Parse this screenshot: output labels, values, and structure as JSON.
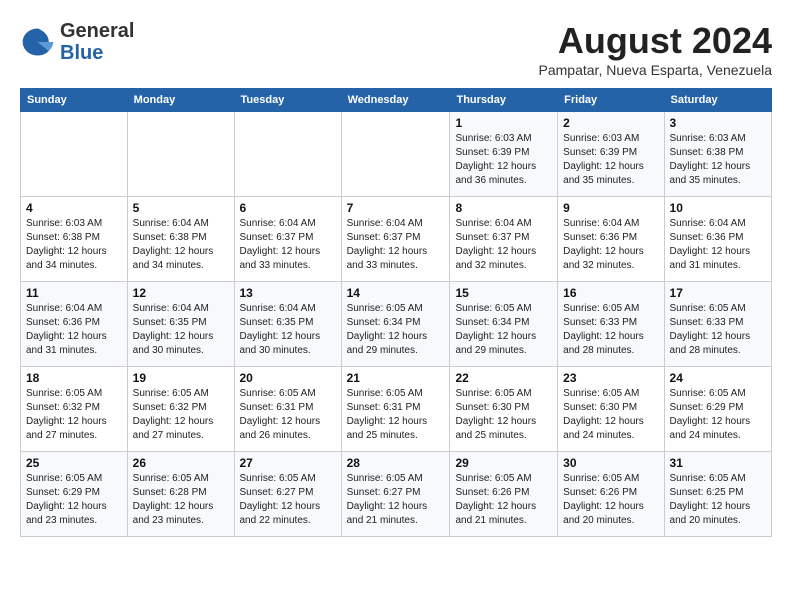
{
  "header": {
    "logo": {
      "general": "General",
      "blue": "Blue"
    },
    "title": "August 2024",
    "location": "Pampatar, Nueva Esparta, Venezuela"
  },
  "weekdays": [
    "Sunday",
    "Monday",
    "Tuesday",
    "Wednesday",
    "Thursday",
    "Friday",
    "Saturday"
  ],
  "weeks": [
    [
      {
        "day": "",
        "sunrise": "",
        "sunset": "",
        "daylight": ""
      },
      {
        "day": "",
        "sunrise": "",
        "sunset": "",
        "daylight": ""
      },
      {
        "day": "",
        "sunrise": "",
        "sunset": "",
        "daylight": ""
      },
      {
        "day": "",
        "sunrise": "",
        "sunset": "",
        "daylight": ""
      },
      {
        "day": "1",
        "sunrise": "Sunrise: 6:03 AM",
        "sunset": "Sunset: 6:39 PM",
        "daylight": "Daylight: 12 hours and 36 minutes."
      },
      {
        "day": "2",
        "sunrise": "Sunrise: 6:03 AM",
        "sunset": "Sunset: 6:39 PM",
        "daylight": "Daylight: 12 hours and 35 minutes."
      },
      {
        "day": "3",
        "sunrise": "Sunrise: 6:03 AM",
        "sunset": "Sunset: 6:38 PM",
        "daylight": "Daylight: 12 hours and 35 minutes."
      }
    ],
    [
      {
        "day": "4",
        "sunrise": "Sunrise: 6:03 AM",
        "sunset": "Sunset: 6:38 PM",
        "daylight": "Daylight: 12 hours and 34 minutes."
      },
      {
        "day": "5",
        "sunrise": "Sunrise: 6:04 AM",
        "sunset": "Sunset: 6:38 PM",
        "daylight": "Daylight: 12 hours and 34 minutes."
      },
      {
        "day": "6",
        "sunrise": "Sunrise: 6:04 AM",
        "sunset": "Sunset: 6:37 PM",
        "daylight": "Daylight: 12 hours and 33 minutes."
      },
      {
        "day": "7",
        "sunrise": "Sunrise: 6:04 AM",
        "sunset": "Sunset: 6:37 PM",
        "daylight": "Daylight: 12 hours and 33 minutes."
      },
      {
        "day": "8",
        "sunrise": "Sunrise: 6:04 AM",
        "sunset": "Sunset: 6:37 PM",
        "daylight": "Daylight: 12 hours and 32 minutes."
      },
      {
        "day": "9",
        "sunrise": "Sunrise: 6:04 AM",
        "sunset": "Sunset: 6:36 PM",
        "daylight": "Daylight: 12 hours and 32 minutes."
      },
      {
        "day": "10",
        "sunrise": "Sunrise: 6:04 AM",
        "sunset": "Sunset: 6:36 PM",
        "daylight": "Daylight: 12 hours and 31 minutes."
      }
    ],
    [
      {
        "day": "11",
        "sunrise": "Sunrise: 6:04 AM",
        "sunset": "Sunset: 6:36 PM",
        "daylight": "Daylight: 12 hours and 31 minutes."
      },
      {
        "day": "12",
        "sunrise": "Sunrise: 6:04 AM",
        "sunset": "Sunset: 6:35 PM",
        "daylight": "Daylight: 12 hours and 30 minutes."
      },
      {
        "day": "13",
        "sunrise": "Sunrise: 6:04 AM",
        "sunset": "Sunset: 6:35 PM",
        "daylight": "Daylight: 12 hours and 30 minutes."
      },
      {
        "day": "14",
        "sunrise": "Sunrise: 6:05 AM",
        "sunset": "Sunset: 6:34 PM",
        "daylight": "Daylight: 12 hours and 29 minutes."
      },
      {
        "day": "15",
        "sunrise": "Sunrise: 6:05 AM",
        "sunset": "Sunset: 6:34 PM",
        "daylight": "Daylight: 12 hours and 29 minutes."
      },
      {
        "day": "16",
        "sunrise": "Sunrise: 6:05 AM",
        "sunset": "Sunset: 6:33 PM",
        "daylight": "Daylight: 12 hours and 28 minutes."
      },
      {
        "day": "17",
        "sunrise": "Sunrise: 6:05 AM",
        "sunset": "Sunset: 6:33 PM",
        "daylight": "Daylight: 12 hours and 28 minutes."
      }
    ],
    [
      {
        "day": "18",
        "sunrise": "Sunrise: 6:05 AM",
        "sunset": "Sunset: 6:32 PM",
        "daylight": "Daylight: 12 hours and 27 minutes."
      },
      {
        "day": "19",
        "sunrise": "Sunrise: 6:05 AM",
        "sunset": "Sunset: 6:32 PM",
        "daylight": "Daylight: 12 hours and 27 minutes."
      },
      {
        "day": "20",
        "sunrise": "Sunrise: 6:05 AM",
        "sunset": "Sunset: 6:31 PM",
        "daylight": "Daylight: 12 hours and 26 minutes."
      },
      {
        "day": "21",
        "sunrise": "Sunrise: 6:05 AM",
        "sunset": "Sunset: 6:31 PM",
        "daylight": "Daylight: 12 hours and 25 minutes."
      },
      {
        "day": "22",
        "sunrise": "Sunrise: 6:05 AM",
        "sunset": "Sunset: 6:30 PM",
        "daylight": "Daylight: 12 hours and 25 minutes."
      },
      {
        "day": "23",
        "sunrise": "Sunrise: 6:05 AM",
        "sunset": "Sunset: 6:30 PM",
        "daylight": "Daylight: 12 hours and 24 minutes."
      },
      {
        "day": "24",
        "sunrise": "Sunrise: 6:05 AM",
        "sunset": "Sunset: 6:29 PM",
        "daylight": "Daylight: 12 hours and 24 minutes."
      }
    ],
    [
      {
        "day": "25",
        "sunrise": "Sunrise: 6:05 AM",
        "sunset": "Sunset: 6:29 PM",
        "daylight": "Daylight: 12 hours and 23 minutes."
      },
      {
        "day": "26",
        "sunrise": "Sunrise: 6:05 AM",
        "sunset": "Sunset: 6:28 PM",
        "daylight": "Daylight: 12 hours and 23 minutes."
      },
      {
        "day": "27",
        "sunrise": "Sunrise: 6:05 AM",
        "sunset": "Sunset: 6:27 PM",
        "daylight": "Daylight: 12 hours and 22 minutes."
      },
      {
        "day": "28",
        "sunrise": "Sunrise: 6:05 AM",
        "sunset": "Sunset: 6:27 PM",
        "daylight": "Daylight: 12 hours and 21 minutes."
      },
      {
        "day": "29",
        "sunrise": "Sunrise: 6:05 AM",
        "sunset": "Sunset: 6:26 PM",
        "daylight": "Daylight: 12 hours and 21 minutes."
      },
      {
        "day": "30",
        "sunrise": "Sunrise: 6:05 AM",
        "sunset": "Sunset: 6:26 PM",
        "daylight": "Daylight: 12 hours and 20 minutes."
      },
      {
        "day": "31",
        "sunrise": "Sunrise: 6:05 AM",
        "sunset": "Sunset: 6:25 PM",
        "daylight": "Daylight: 12 hours and 20 minutes."
      }
    ]
  ]
}
